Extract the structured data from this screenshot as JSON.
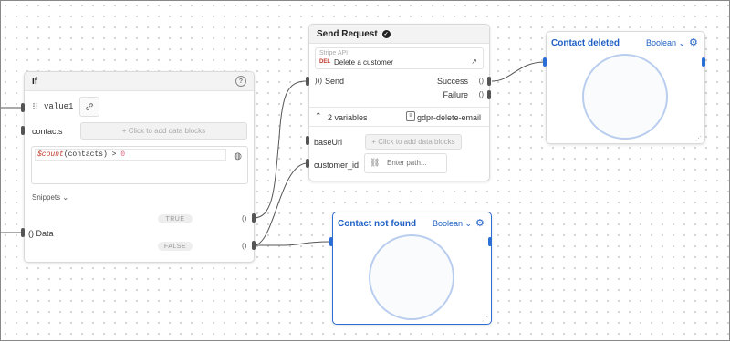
{
  "if_node": {
    "title": "If",
    "help_icon": "question-circle-icon",
    "value_label": "value1",
    "contacts_label": "contacts",
    "add_data_blocks": "+ Click to add data blocks",
    "expression": {
      "fn": "$count",
      "arg": "(contacts)",
      "op": " > ",
      "num": "0"
    },
    "snippets_label": "Snippets",
    "data_label": "() Data",
    "true_label": "TRUE",
    "false_label": "FALSE",
    "port_paren": "()"
  },
  "send_request": {
    "title": "Send Request",
    "status_icon": "check-circle-icon",
    "api_name": "Stripe API",
    "method": "DEL",
    "endpoint": "Delete a customer",
    "send_label": "Send",
    "success_label": "Success",
    "failure_label": "Failure",
    "paren": "()",
    "variables_label": "2 variables",
    "variables_file": "gdpr-delete-email",
    "baseurl_label": "baseUrl",
    "baseurl_add": "+ Click to add data blocks",
    "customer_id_label": "customer_id",
    "path_placeholder": "Enter path..."
  },
  "contact_deleted": {
    "title": "Contact deleted",
    "type": "Boolean"
  },
  "contact_not_found": {
    "title": "Contact not found",
    "type": "Boolean"
  },
  "colors": {
    "accent": "#1f5fc4",
    "expr_fn": "#c0392b",
    "expr_num": "#e0607a"
  }
}
